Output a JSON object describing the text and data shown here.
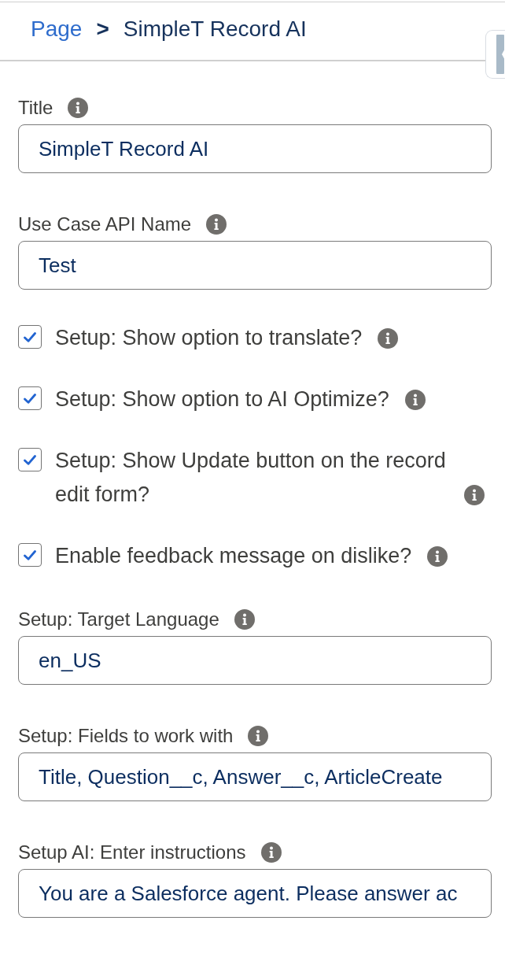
{
  "breadcrumb": {
    "parent": "Page",
    "separator": ">",
    "current": "SimpleT Record AI"
  },
  "form": {
    "items": [
      {
        "kind": "text",
        "label": "Title",
        "value": "SimpleT Record AI"
      },
      {
        "kind": "text",
        "label": "Use Case API Name",
        "value": "Test"
      },
      {
        "kind": "checkbox",
        "label": "Setup: Show option to translate?",
        "checked": true
      },
      {
        "kind": "checkbox",
        "label": "Setup: Show option to AI Optimize?",
        "checked": true
      },
      {
        "kind": "checkbox",
        "label": "Setup: Show Update button on the record edit form?",
        "checked": true
      },
      {
        "kind": "checkbox",
        "label": "Enable feedback message on dislike?",
        "checked": true
      },
      {
        "kind": "text",
        "label": "Setup: Target Language",
        "value": "en_US"
      },
      {
        "kind": "text",
        "label": "Setup: Fields to work with",
        "value": "Title, Question__c, Answer__c, ArticleCreate"
      },
      {
        "kind": "text",
        "label": "Setup AI: Enter instructions",
        "value": "You are a Salesforce agent. Please answer ac"
      }
    ]
  }
}
